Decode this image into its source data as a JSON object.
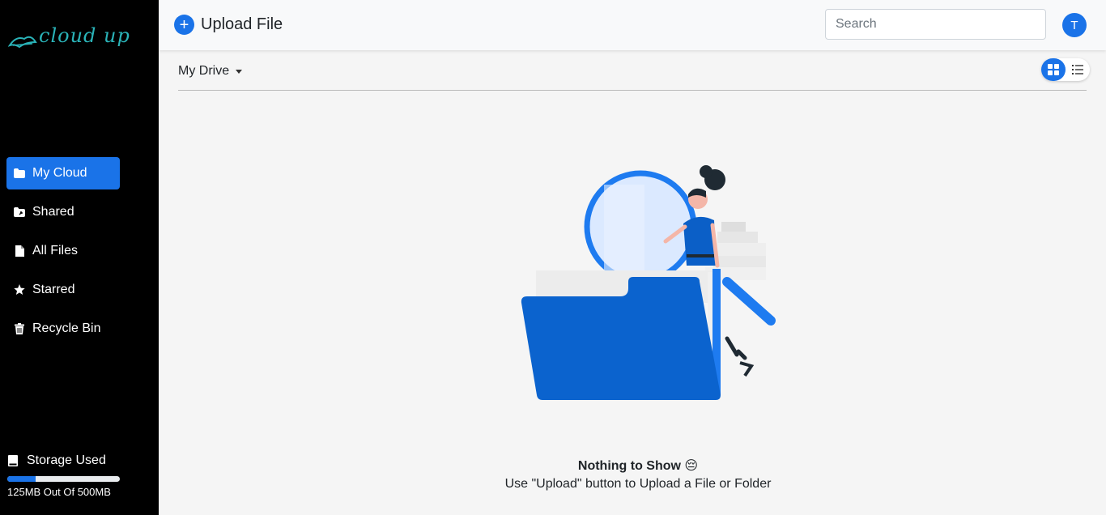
{
  "app": {
    "logo_text": "cloud up"
  },
  "sidebar": {
    "items": [
      {
        "label": "My Cloud",
        "icon": "folder-icon",
        "active": true
      },
      {
        "label": "Shared",
        "icon": "shared-folder-icon",
        "active": false
      },
      {
        "label": "All Files",
        "icon": "file-icon",
        "active": false
      },
      {
        "label": "Starred",
        "icon": "star-icon",
        "active": false
      },
      {
        "label": "Recycle Bin",
        "icon": "trash-icon",
        "active": false
      }
    ],
    "storage": {
      "title": "Storage Used",
      "used_fraction": 0.25,
      "summary": "125MB Out Of 500MB",
      "icon": "drive-icon"
    }
  },
  "header": {
    "upload_label": "Upload File",
    "upload_icon": "+",
    "search_placeholder": "Search",
    "avatar_initial": "T"
  },
  "toolbar": {
    "drive_label": "My Drive",
    "view_mode": "grid"
  },
  "empty_state": {
    "title": "Nothing to Show 😔",
    "subtitle": "Use \"Upload\" button to Upload a File or Folder"
  },
  "colors": {
    "accent": "#1a73e8",
    "sidebar_bg": "#000000",
    "logo": "#2ab3b8",
    "folder": "#0b63ce"
  }
}
